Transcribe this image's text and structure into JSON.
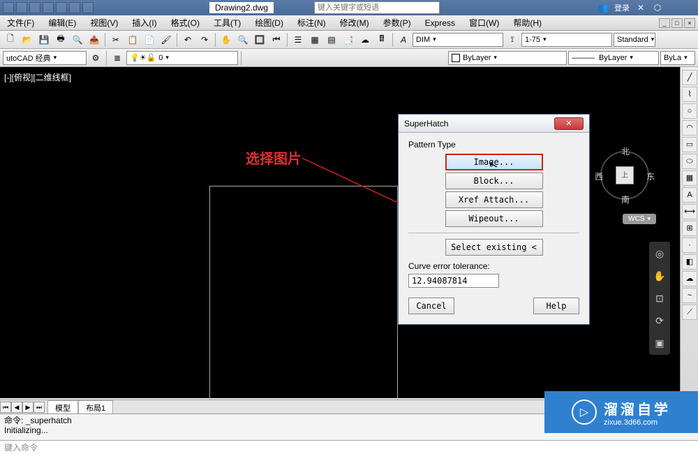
{
  "titlebar": {
    "filename": "Drawing2.dwg",
    "search_placeholder": "键入关键字或短语",
    "login_label": "登录"
  },
  "menubar": {
    "items": [
      "文件(F)",
      "编辑(E)",
      "视图(V)",
      "插入(I)",
      "格式(O)",
      "工具(T)",
      "绘图(D)",
      "标注(N)",
      "修改(M)",
      "参数(P)",
      "Express",
      "窗口(W)",
      "帮助(H)"
    ]
  },
  "toolbar1": {
    "textstyle": "DIM",
    "dimscale": "1-75",
    "standard": "Standard"
  },
  "toolbar2": {
    "workspace": "utoCAD 经典",
    "layer_state": "0",
    "color": "ByLayer",
    "linetype": "ByLayer",
    "lineweight": "ByLa"
  },
  "viewport": {
    "label": "[-][俯视][二维线框]"
  },
  "annotation": {
    "text": "选择图片"
  },
  "viewcube": {
    "center": "上",
    "n": "北",
    "s": "南",
    "e": "东",
    "w": "西",
    "wcs": "WCS"
  },
  "dialog": {
    "title": "SuperHatch",
    "section": "Pattern Type",
    "btn_image": "Image...",
    "btn_block": "Block...",
    "btn_xref": "Xref Attach...",
    "btn_wipeout": "Wipeout...",
    "btn_select": "Select existing <",
    "tolerance_label": "Curve error tolerance:",
    "tolerance_value": "12.94087814",
    "btn_cancel": "Cancel",
    "btn_help": "Help",
    "close_x": "✕"
  },
  "tabs": {
    "model": "模型",
    "layout1": "布局1"
  },
  "cmdline": {
    "line1": "命令: _superhatch",
    "line2": "Initializing...",
    "prompt": "键入命令"
  },
  "watermark": {
    "main": "溜溜自学",
    "sub": "zixue.3d66.com"
  }
}
